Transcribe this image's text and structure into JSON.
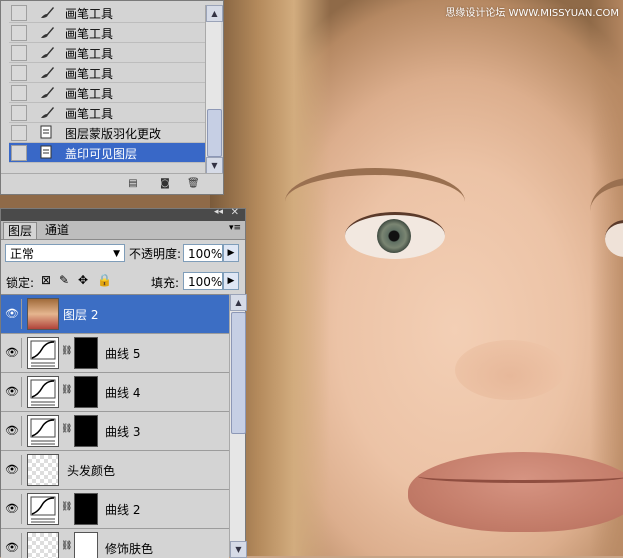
{
  "watermark": "思缘设计论坛 WWW.MISSYUAN.COM",
  "history": {
    "items": [
      {
        "label": "画笔工具",
        "icon": "brush-icon"
      },
      {
        "label": "画笔工具",
        "icon": "brush-icon"
      },
      {
        "label": "画笔工具",
        "icon": "brush-icon"
      },
      {
        "label": "画笔工具",
        "icon": "brush-icon"
      },
      {
        "label": "画笔工具",
        "icon": "brush-icon"
      },
      {
        "label": "画笔工具",
        "icon": "brush-icon"
      },
      {
        "label": "图层蒙版羽化更改",
        "icon": "document-icon"
      },
      {
        "label": "盖印可见图层",
        "icon": "document-icon"
      }
    ]
  },
  "layers_panel": {
    "tabs": [
      {
        "label": "图层"
      },
      {
        "label": "通道"
      }
    ],
    "blend_mode": "正常",
    "opacity_label": "不透明度:",
    "opacity_value": "100%",
    "lock_label": "锁定:",
    "fill_label": "填充:",
    "fill_value": "100%",
    "layers": [
      {
        "name": "图层 2",
        "type": "image",
        "selected": true
      },
      {
        "name": "曲线 5",
        "type": "curves"
      },
      {
        "name": "曲线 4",
        "type": "curves"
      },
      {
        "name": "曲线 3",
        "type": "curves"
      },
      {
        "name": "头发颜色",
        "type": "pixel"
      },
      {
        "name": "曲线 2",
        "type": "curves"
      },
      {
        "name": "修饰肤色",
        "type": "pixel-mask"
      }
    ]
  },
  "colors": {
    "selection": "#3968c7",
    "panel": "#d4d4d4"
  }
}
